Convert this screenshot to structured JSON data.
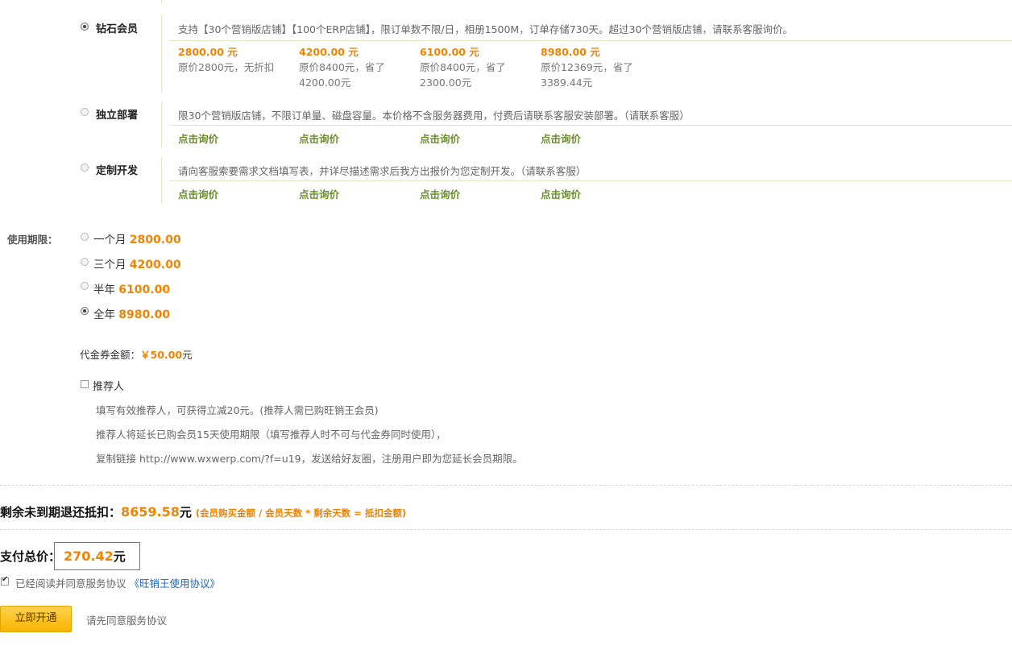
{
  "plans": [
    {
      "name": "钻石会员",
      "checked": true,
      "desc": "支持【30个营销版店铺】【100个ERP店铺】，限订单数不限/日，相册1500M，订单存储730天。超过30个营销版店铺，请联系客服询价。",
      "prices": [
        {
          "price": "2800.00 元",
          "orig1": "原价2800元，无折扣",
          "orig2": ""
        },
        {
          "price": "4200.00 元",
          "orig1": "原价8400元，省了",
          "orig2": "4200.00元"
        },
        {
          "price": "6100.00 元",
          "orig1": "原价8400元，省了",
          "orig2": "2300.00元"
        },
        {
          "price": "8980.00 元",
          "orig1": "原价12369元，省了",
          "orig2": "3389.44元"
        }
      ]
    },
    {
      "name": "独立部署",
      "checked": false,
      "desc": "限30个营销版店铺，不限订单量、磁盘容量。本价格不含服务器费用，付费后请联系客服安装部署。（请联系客服）",
      "asks": [
        "点击询价",
        "点击询价",
        "点击询价",
        "点击询价"
      ]
    },
    {
      "name": "定制开发",
      "checked": false,
      "desc": "请向客服索要需求文档填写表，并详尽描述需求后我方出报价为您定制开发。（请联系客服）",
      "asks": [
        "点击询价",
        "点击询价",
        "点击询价",
        "点击询价"
      ]
    }
  ],
  "period": {
    "label": "使用期限：",
    "options": [
      {
        "name": "一个月",
        "price": "2800.00",
        "checked": false
      },
      {
        "name": "三个月",
        "price": "4200.00",
        "checked": false
      },
      {
        "name": "半年",
        "price": "6100.00",
        "checked": false
      },
      {
        "name": "全年",
        "price": "8980.00",
        "checked": true
      }
    ]
  },
  "voucher": {
    "label": "代金券金额：",
    "amount": "￥50.00",
    "unit": "元"
  },
  "referrer": {
    "label": "推荐人",
    "lines": [
      "填写有效推荐人，可获得立减20元。(推荐人需已购旺销王会员)",
      "推荐人将延长已购会员15天使用期限（填写推荐人时不可与代金券同时使用），",
      "复制链接 http://www.wxwerp.com/?f=u19，发送给好友圈，注册用户即为您延长会员期限。"
    ]
  },
  "refund": {
    "label": "剩余未到期退还抵扣：",
    "amount": "8659.58",
    "unit": "元",
    "formula": "(会员购买金额 / 会员天数 * 剩余天数 = 抵扣金额)"
  },
  "total": {
    "label": "支付总价：",
    "amount": "270.42",
    "unit": "元"
  },
  "agreement": {
    "text": "已经阅读并同意服务协议",
    "link": "《旺销王使用协议》",
    "checked": true
  },
  "submit": {
    "label": "立即开通",
    "hint": "请先同意服务协议"
  }
}
